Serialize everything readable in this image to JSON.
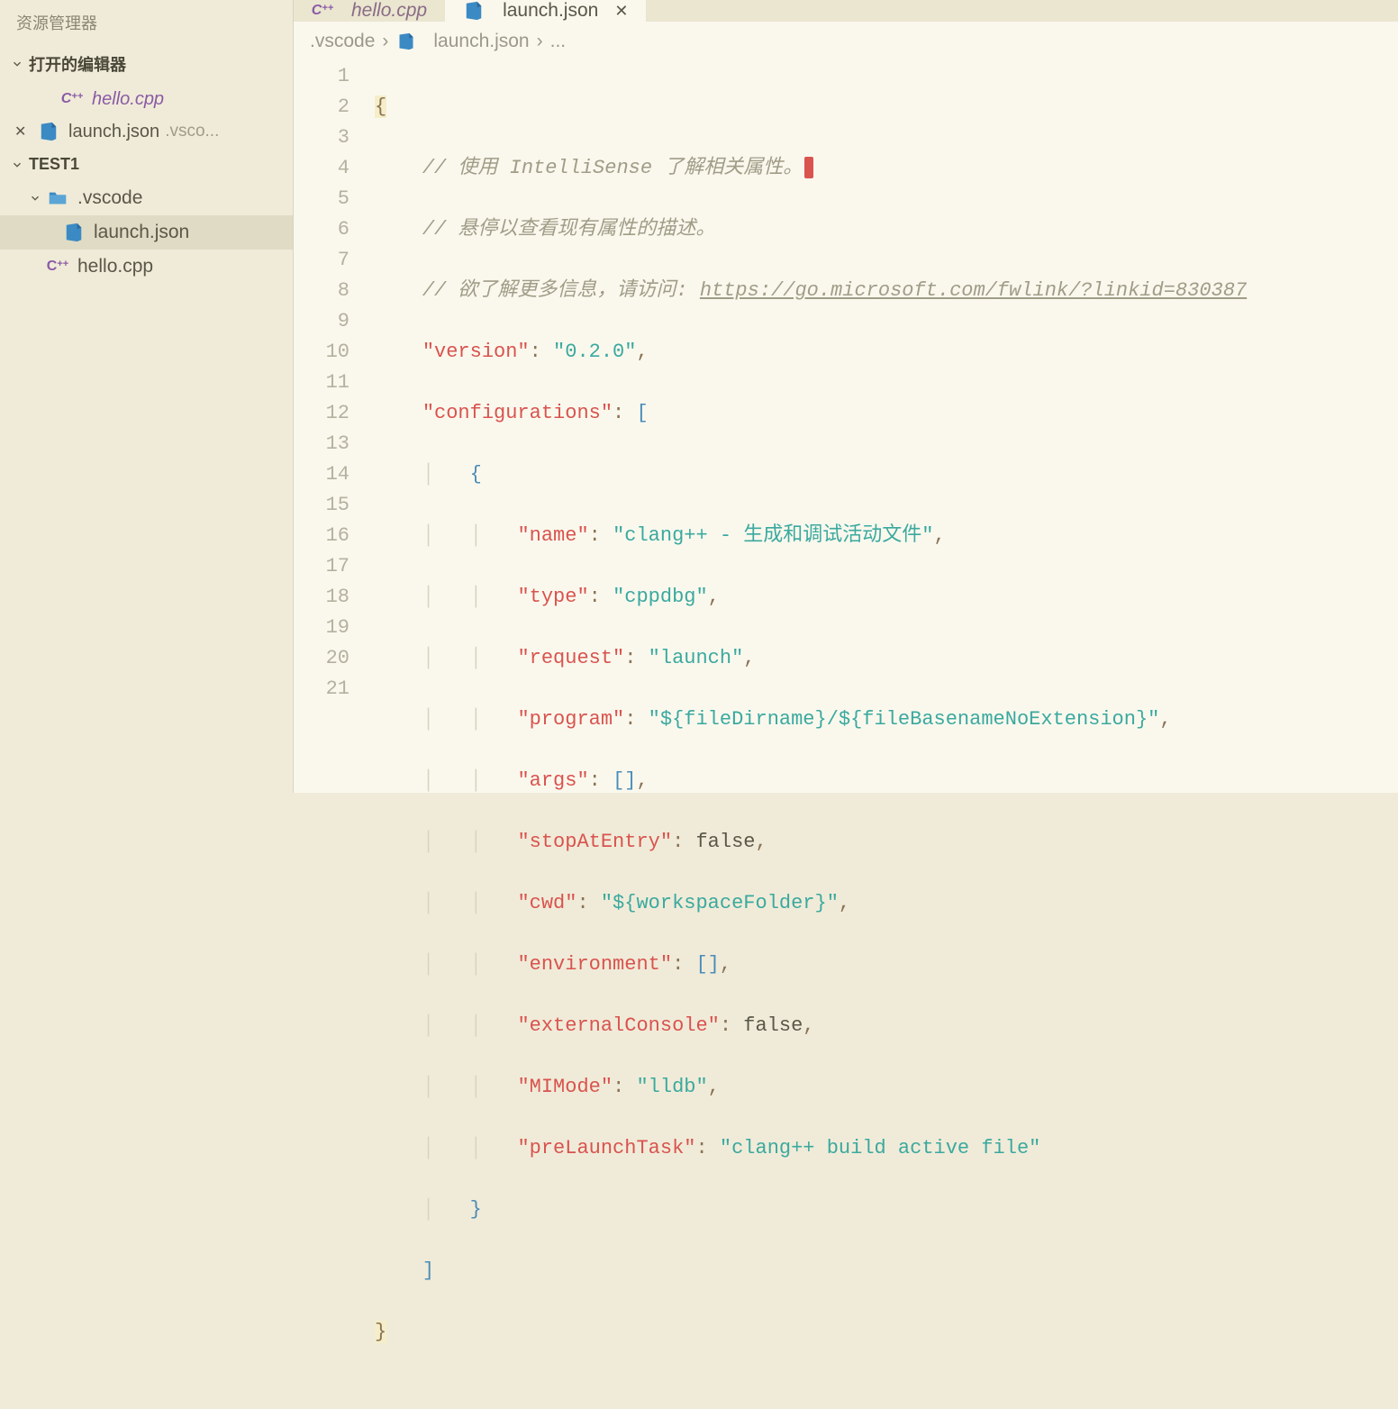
{
  "sidebar": {
    "title": "资源管理器",
    "open_editors_header": "打开的编辑器",
    "open_editors": [
      {
        "name": "hello.cpp",
        "icon": "cpp",
        "italic": true,
        "closable": false
      },
      {
        "name": "launch.json",
        "icon": "vscode-json",
        "italic": false,
        "closable": true,
        "dir": ".vsco..."
      }
    ],
    "folder_header": "TEST1",
    "tree": {
      "folder": ".vscode",
      "file1": "launch.json",
      "file2": "hello.cpp"
    }
  },
  "tabs": [
    {
      "name": "hello.cpp",
      "icon": "cpp",
      "active": false
    },
    {
      "name": "launch.json",
      "icon": "vscode-json",
      "active": true
    }
  ],
  "breadcrumb": {
    "seg1": ".vscode",
    "seg2": "launch.json",
    "seg3": "..."
  },
  "code": {
    "comment1": "// 使用 IntelliSense 了解相关属性。",
    "comment2": "// 悬停以查看现有属性的描述。",
    "comment3_prefix": "// 欲了解更多信息，请访问: ",
    "comment3_url": "https://go.microsoft.com/fwlink/?linkid=830387",
    "k_version": "\"version\"",
    "v_version": "\"0.2.0\"",
    "k_configurations": "\"configurations\"",
    "k_name": "\"name\"",
    "v_name": "\"clang++ - 生成和调试活动文件\"",
    "k_type": "\"type\"",
    "v_type": "\"cppdbg\"",
    "k_request": "\"request\"",
    "v_request": "\"launch\"",
    "k_program": "\"program\"",
    "v_program": "\"${fileDirname}/${fileBasenameNoExtension}\"",
    "k_args": "\"args\"",
    "k_stopAtEntry": "\"stopAtEntry\"",
    "v_false": "false",
    "k_cwd": "\"cwd\"",
    "v_cwd": "\"${workspaceFolder}\"",
    "k_environment": "\"environment\"",
    "k_externalConsole": "\"externalConsole\"",
    "k_MIMode": "\"MIMode\"",
    "v_MIMode": "\"lldb\"",
    "k_preLaunchTask": "\"preLaunchTask\"",
    "v_preLaunchTask": "\"clang++ build active file\""
  },
  "line_numbers": [
    "1",
    "2",
    "3",
    "4",
    "5",
    "6",
    "7",
    "8",
    "9",
    "10",
    "11",
    "12",
    "13",
    "14",
    "15",
    "16",
    "17",
    "18",
    "19",
    "20",
    "21"
  ]
}
